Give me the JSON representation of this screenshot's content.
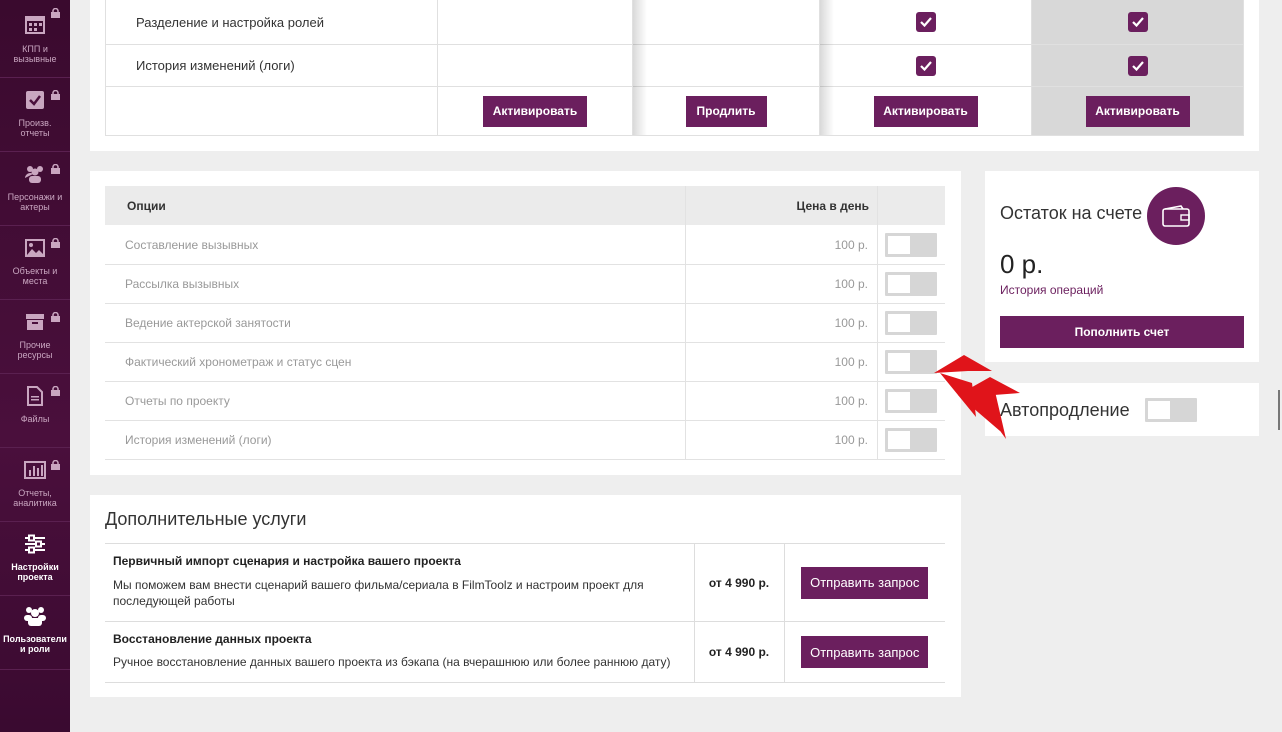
{
  "sidebar": {
    "items": [
      {
        "label": "КПП и вызывные",
        "icon": "calendar-icon",
        "locked": true
      },
      {
        "label": "Произв. отчеты",
        "icon": "checkbox-icon",
        "locked": true
      },
      {
        "label": "Персонажи и актеры",
        "icon": "people-icon",
        "locked": true
      },
      {
        "label": "Объекты и места",
        "icon": "image-icon",
        "locked": true
      },
      {
        "label": "Прочие ресурсы",
        "icon": "archive-icon",
        "locked": true
      },
      {
        "label": "Файлы",
        "icon": "file-icon",
        "locked": true
      },
      {
        "label": "Отчеты, аналитика",
        "icon": "chart-icon",
        "locked": true
      },
      {
        "label": "Настройки проекта",
        "icon": "sliders-icon",
        "locked": false,
        "active": true
      },
      {
        "label": "Пользователи и роли",
        "icon": "users-icon",
        "locked": false,
        "active": true
      }
    ]
  },
  "plans_table": {
    "rows": [
      {
        "label": "Разделение и настройка ролей",
        "checks": [
          false,
          false,
          true,
          true
        ]
      },
      {
        "label": "История изменений (логи)",
        "checks": [
          false,
          false,
          true,
          true
        ]
      }
    ],
    "buttons": [
      "Активировать",
      "Продлить",
      "Активировать",
      "Активировать"
    ]
  },
  "options": {
    "header_option": "Опции",
    "header_price": "Цена в день",
    "rows": [
      {
        "name": "Составление вызывных",
        "price": "100 р.",
        "enabled": false
      },
      {
        "name": "Рассылка вызывных",
        "price": "100 р.",
        "enabled": false
      },
      {
        "name": "Ведение актерской занятости",
        "price": "100 р.",
        "enabled": false
      },
      {
        "name": "Фактический хронометраж и статус сцен",
        "price": "100 р.",
        "enabled": false
      },
      {
        "name": "Отчеты по проекту",
        "price": "100 р.",
        "enabled": false
      },
      {
        "name": "История изменений (логи)",
        "price": "100 р.",
        "enabled": false
      }
    ]
  },
  "balance": {
    "title": "Остаток на счете",
    "amount": "0 р.",
    "history_link": "История операций",
    "topup_button": "Пополнить счет"
  },
  "autorenew": {
    "label": "Автопродление",
    "enabled": false
  },
  "services": {
    "title": "Дополнительные услуги",
    "items": [
      {
        "name": "Первичный импорт сценария и настройка вашего проекта",
        "description": "Мы поможем вам внести сценарий вашего фильма/сериала в FilmToolz и настроим проект для последующей работы",
        "price": "от 4 990 р.",
        "button": "Отправить запрос"
      },
      {
        "name": "Восстановление данных проекта",
        "description": "Ручное восстановление данных вашего проекта из бэкапа (на вчерашнюю или более раннюю дату)",
        "price": "от 4 990 р.",
        "button": "Отправить запрос"
      }
    ]
  },
  "colors": {
    "brand": "#6b1f5e",
    "sidebar": "#3f0c34",
    "arrow": "#e0141a"
  }
}
